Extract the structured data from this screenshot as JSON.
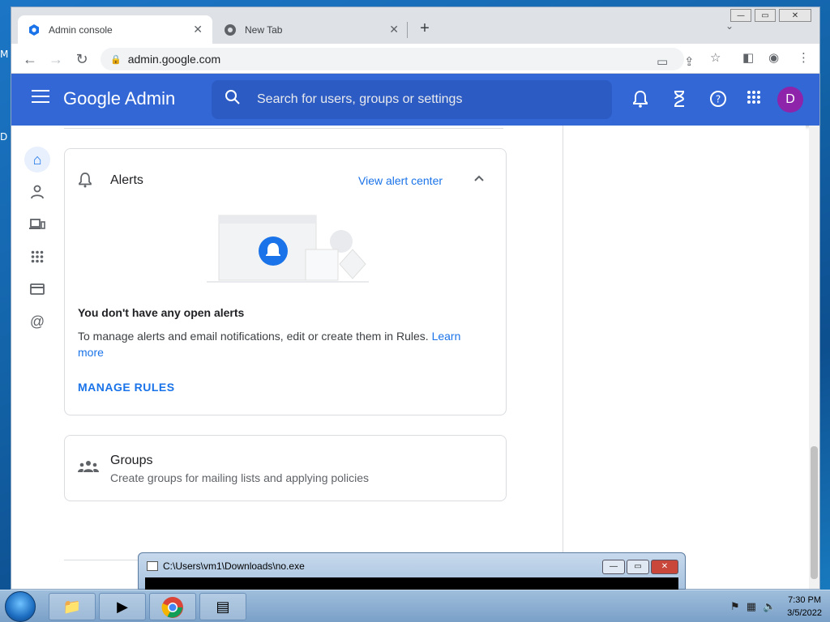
{
  "desktop": {
    "letters": [
      "M",
      "D"
    ]
  },
  "browser": {
    "tabs": [
      {
        "title": "Admin console",
        "close": "✕"
      },
      {
        "title": "New Tab",
        "close": "✕"
      }
    ],
    "new_tab": "+",
    "tab_dropdown": "⌄",
    "window_controls": {
      "minimize": "—",
      "maximize": "▭",
      "close": "✕"
    },
    "nav": {
      "back": "←",
      "forward": "→",
      "reload": "↻"
    },
    "url": "admin.google.com",
    "lock": "🔒"
  },
  "admin": {
    "logo": "Google Admin",
    "search_placeholder": "Search for users, groups or settings",
    "avatar_initial": "D"
  },
  "alerts_card": {
    "title": "Alerts",
    "view_link": "View alert center",
    "empty_title": "You don't have any open alerts",
    "empty_desc": "To manage alerts and email notifications, edit or create them in Rules.",
    "learn_more": "Learn more",
    "manage_rules": "MANAGE RULES"
  },
  "groups_card": {
    "title": "Groups",
    "desc": "Create groups for mailing lists and applying policies"
  },
  "console_window": {
    "title": "C:\\Users\\vm1\\Downloads\\no.exe"
  },
  "taskbar": {
    "time": "7:30 PM",
    "date": "3/5/2022"
  }
}
